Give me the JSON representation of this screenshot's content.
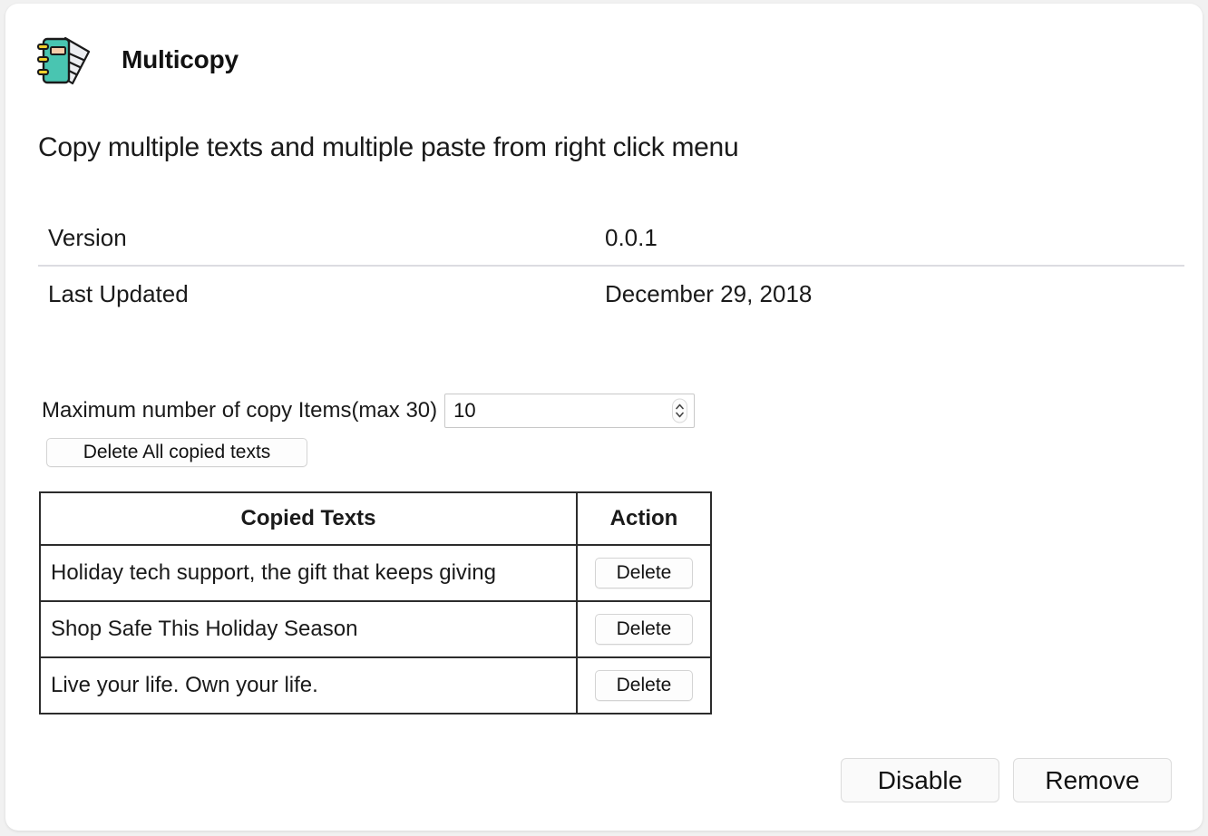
{
  "app": {
    "name": "Multicopy",
    "icon": "notebook-papers-icon",
    "description": "Copy multiple texts and multiple paste from right click menu"
  },
  "details": [
    {
      "label": "Version",
      "value": "0.0.1"
    },
    {
      "label": "Last Updated",
      "value": "December 29, 2018"
    }
  ],
  "settings": {
    "max_items_label": "Maximum number of copy Items(max 30)",
    "max_items_value": "10",
    "max_items_placeholder": "10",
    "delete_all_label": "Delete All copied texts"
  },
  "table": {
    "headers": [
      "Copied Texts",
      "Action"
    ],
    "rows": [
      {
        "text": "Holiday tech support, the gift that keeps giving",
        "action": "Delete"
      },
      {
        "text": "Shop Safe This Holiday Season",
        "action": "Delete"
      },
      {
        "text": "Live your life. Own your life.",
        "action": "Delete"
      }
    ]
  },
  "footer": {
    "disable_label": "Disable",
    "remove_label": "Remove"
  },
  "colors": {
    "icon_teal": "#49c5b1",
    "icon_yellow": "#f2d02c",
    "icon_label": "#f7cdaa",
    "table_border": "#2c2c2c",
    "divider": "#dcdce1"
  }
}
